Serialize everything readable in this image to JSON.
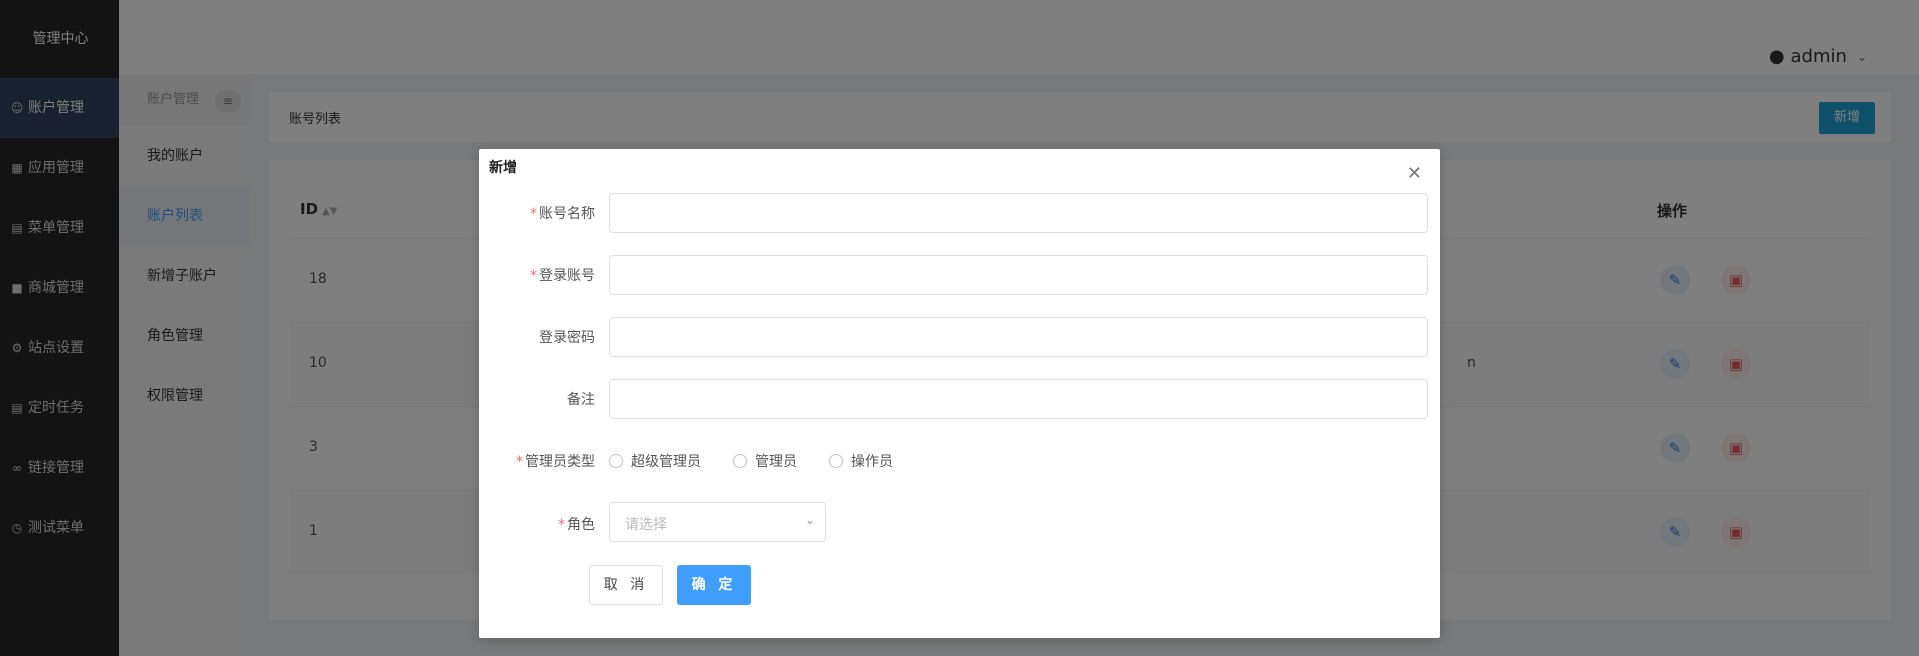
{
  "sidebar": {
    "brand": "管理中心",
    "items": [
      {
        "label": "账户管理",
        "icon": "user-icon"
      },
      {
        "label": "应用管理",
        "icon": "grid-icon"
      },
      {
        "label": "菜单管理",
        "icon": "list-icon"
      },
      {
        "label": "商城管理",
        "icon": "shop-icon"
      },
      {
        "label": "站点设置",
        "icon": "gear-icon"
      },
      {
        "label": "定时任务",
        "icon": "clock-doc-icon"
      },
      {
        "label": "链接管理",
        "icon": "link-icon"
      },
      {
        "label": "测试菜单",
        "icon": "timer-icon"
      }
    ]
  },
  "header": {
    "username": "admin"
  },
  "submenu": {
    "title": "账户管理",
    "items": [
      "我的账户",
      "账户列表",
      "新增子账户",
      "角色管理",
      "权限管理"
    ]
  },
  "main": {
    "panel_title": "账号列表",
    "new_button": "新增",
    "columns": {
      "id": "ID",
      "actions": "操作"
    },
    "rows": [
      {
        "id": "18"
      },
      {
        "id": "10"
      },
      {
        "id": "3"
      },
      {
        "id": "1"
      }
    ],
    "partial_text": "n"
  },
  "modal": {
    "title": "新增",
    "fields": {
      "account_name": {
        "label": "账号名称",
        "required": true,
        "value": ""
      },
      "login_account": {
        "label": "登录账号",
        "required": true,
        "value": ""
      },
      "login_password": {
        "label": "登录密码",
        "required": false,
        "value": ""
      },
      "remark": {
        "label": "备注",
        "required": false,
        "value": ""
      },
      "admin_type": {
        "label": "管理员类型",
        "required": true,
        "options": [
          "超级管理员",
          "管理员",
          "操作员"
        ]
      },
      "role": {
        "label": "角色",
        "required": true,
        "placeholder": "请选择"
      }
    },
    "cancel_label": "取 消",
    "confirm_label": "确 定"
  },
  "colors": {
    "sidebar_bg": "#272727",
    "primary": "#409eff",
    "new_button": "#1fa2d5",
    "danger": "#e65a5a"
  }
}
